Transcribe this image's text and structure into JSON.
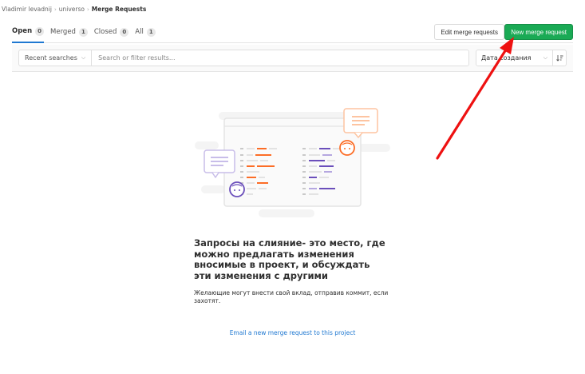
{
  "breadcrumb": {
    "user": "Vladimir levadnij",
    "project": "universo",
    "current": "Merge Requests"
  },
  "tabs": [
    {
      "label": "Open",
      "count": "0",
      "active": true
    },
    {
      "label": "Merged",
      "count": "1",
      "active": false
    },
    {
      "label": "Closed",
      "count": "0",
      "active": false
    },
    {
      "label": "All",
      "count": "1",
      "active": false
    }
  ],
  "actions": {
    "edit_label": "Edit merge requests",
    "new_label": "New merge request",
    "new_color": "#1aaa55"
  },
  "filter": {
    "recent_label": "Recent searches",
    "placeholder": "Search or filter results...",
    "sort_label": "Дата создания"
  },
  "icons": {
    "recent_chevron": "chevron-down-icon",
    "sort_chevron": "chevron-down-icon",
    "sort_direction": "sort-lowest-icon"
  },
  "empty_state": {
    "title": "Запросы на слияние- это место, где можно предлагать изменения вносимые в проект, и обсуждать эти изменения с другими",
    "description": "Желающие могут внести свой вклад, отправив коммит, если захотят.",
    "email_link": "Email a new merge request to this project"
  },
  "annotation": {
    "arrow_color": "#ee1111"
  }
}
